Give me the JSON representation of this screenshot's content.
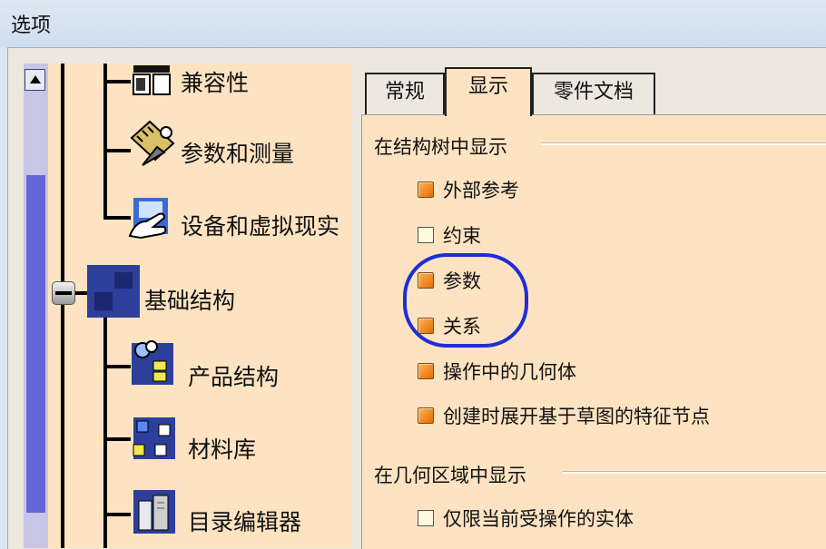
{
  "window": {
    "title": "选项"
  },
  "tree": {
    "items": [
      {
        "label": "兼容性",
        "icon": "compatibility-icon"
      },
      {
        "label": "参数和测量",
        "icon": "parameters-measure-icon"
      },
      {
        "label": "设备和虚拟现实",
        "icon": "devices-vr-icon"
      },
      {
        "label": "基础结构",
        "icon": "infrastructure-icon"
      },
      {
        "label": "产品结构",
        "icon": "product-structure-icon"
      },
      {
        "label": "材料库",
        "icon": "material-library-icon"
      },
      {
        "label": "目录编辑器",
        "icon": "catalog-editor-icon"
      }
    ]
  },
  "tabs": [
    {
      "label": "常规"
    },
    {
      "label": "显示",
      "active": true
    },
    {
      "label": "零件文档"
    }
  ],
  "groups": [
    {
      "title": "在结构树中显示",
      "options": [
        {
          "label": "外部参考",
          "checked": true
        },
        {
          "label": "约束",
          "checked": false
        },
        {
          "label": "参数",
          "checked": true
        },
        {
          "label": "关系",
          "checked": true
        },
        {
          "label": "操作中的几何体",
          "checked": true
        },
        {
          "label": "创建时展开基于草图的特征节点",
          "checked": true
        }
      ]
    },
    {
      "title": "在几何区域中显示",
      "options": [
        {
          "label": "仅限当前受操作的实体",
          "checked": false
        }
      ]
    }
  ],
  "colors": {
    "pane_bg": "#fde3c2",
    "checkbox_checked": "#f08a1c",
    "scroll_thumb": "#6567d8",
    "highlight_circle": "#1e2ed6"
  }
}
